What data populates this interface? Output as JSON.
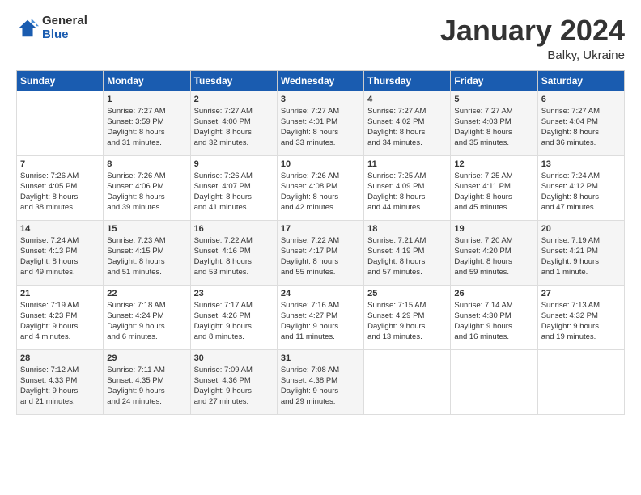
{
  "logo": {
    "general": "General",
    "blue": "Blue"
  },
  "title": "January 2024",
  "subtitle": "Balky, Ukraine",
  "days_header": [
    "Sunday",
    "Monday",
    "Tuesday",
    "Wednesday",
    "Thursday",
    "Friday",
    "Saturday"
  ],
  "weeks": [
    [
      {
        "num": "",
        "info": ""
      },
      {
        "num": "1",
        "info": "Sunrise: 7:27 AM\nSunset: 3:59 PM\nDaylight: 8 hours\nand 31 minutes."
      },
      {
        "num": "2",
        "info": "Sunrise: 7:27 AM\nSunset: 4:00 PM\nDaylight: 8 hours\nand 32 minutes."
      },
      {
        "num": "3",
        "info": "Sunrise: 7:27 AM\nSunset: 4:01 PM\nDaylight: 8 hours\nand 33 minutes."
      },
      {
        "num": "4",
        "info": "Sunrise: 7:27 AM\nSunset: 4:02 PM\nDaylight: 8 hours\nand 34 minutes."
      },
      {
        "num": "5",
        "info": "Sunrise: 7:27 AM\nSunset: 4:03 PM\nDaylight: 8 hours\nand 35 minutes."
      },
      {
        "num": "6",
        "info": "Sunrise: 7:27 AM\nSunset: 4:04 PM\nDaylight: 8 hours\nand 36 minutes."
      }
    ],
    [
      {
        "num": "7",
        "info": "Sunrise: 7:26 AM\nSunset: 4:05 PM\nDaylight: 8 hours\nand 38 minutes."
      },
      {
        "num": "8",
        "info": "Sunrise: 7:26 AM\nSunset: 4:06 PM\nDaylight: 8 hours\nand 39 minutes."
      },
      {
        "num": "9",
        "info": "Sunrise: 7:26 AM\nSunset: 4:07 PM\nDaylight: 8 hours\nand 41 minutes."
      },
      {
        "num": "10",
        "info": "Sunrise: 7:26 AM\nSunset: 4:08 PM\nDaylight: 8 hours\nand 42 minutes."
      },
      {
        "num": "11",
        "info": "Sunrise: 7:25 AM\nSunset: 4:09 PM\nDaylight: 8 hours\nand 44 minutes."
      },
      {
        "num": "12",
        "info": "Sunrise: 7:25 AM\nSunset: 4:11 PM\nDaylight: 8 hours\nand 45 minutes."
      },
      {
        "num": "13",
        "info": "Sunrise: 7:24 AM\nSunset: 4:12 PM\nDaylight: 8 hours\nand 47 minutes."
      }
    ],
    [
      {
        "num": "14",
        "info": "Sunrise: 7:24 AM\nSunset: 4:13 PM\nDaylight: 8 hours\nand 49 minutes."
      },
      {
        "num": "15",
        "info": "Sunrise: 7:23 AM\nSunset: 4:15 PM\nDaylight: 8 hours\nand 51 minutes."
      },
      {
        "num": "16",
        "info": "Sunrise: 7:22 AM\nSunset: 4:16 PM\nDaylight: 8 hours\nand 53 minutes."
      },
      {
        "num": "17",
        "info": "Sunrise: 7:22 AM\nSunset: 4:17 PM\nDaylight: 8 hours\nand 55 minutes."
      },
      {
        "num": "18",
        "info": "Sunrise: 7:21 AM\nSunset: 4:19 PM\nDaylight: 8 hours\nand 57 minutes."
      },
      {
        "num": "19",
        "info": "Sunrise: 7:20 AM\nSunset: 4:20 PM\nDaylight: 8 hours\nand 59 minutes."
      },
      {
        "num": "20",
        "info": "Sunrise: 7:19 AM\nSunset: 4:21 PM\nDaylight: 9 hours\nand 1 minute."
      }
    ],
    [
      {
        "num": "21",
        "info": "Sunrise: 7:19 AM\nSunset: 4:23 PM\nDaylight: 9 hours\nand 4 minutes."
      },
      {
        "num": "22",
        "info": "Sunrise: 7:18 AM\nSunset: 4:24 PM\nDaylight: 9 hours\nand 6 minutes."
      },
      {
        "num": "23",
        "info": "Sunrise: 7:17 AM\nSunset: 4:26 PM\nDaylight: 9 hours\nand 8 minutes."
      },
      {
        "num": "24",
        "info": "Sunrise: 7:16 AM\nSunset: 4:27 PM\nDaylight: 9 hours\nand 11 minutes."
      },
      {
        "num": "25",
        "info": "Sunrise: 7:15 AM\nSunset: 4:29 PM\nDaylight: 9 hours\nand 13 minutes."
      },
      {
        "num": "26",
        "info": "Sunrise: 7:14 AM\nSunset: 4:30 PM\nDaylight: 9 hours\nand 16 minutes."
      },
      {
        "num": "27",
        "info": "Sunrise: 7:13 AM\nSunset: 4:32 PM\nDaylight: 9 hours\nand 19 minutes."
      }
    ],
    [
      {
        "num": "28",
        "info": "Sunrise: 7:12 AM\nSunset: 4:33 PM\nDaylight: 9 hours\nand 21 minutes."
      },
      {
        "num": "29",
        "info": "Sunrise: 7:11 AM\nSunset: 4:35 PM\nDaylight: 9 hours\nand 24 minutes."
      },
      {
        "num": "30",
        "info": "Sunrise: 7:09 AM\nSunset: 4:36 PM\nDaylight: 9 hours\nand 27 minutes."
      },
      {
        "num": "31",
        "info": "Sunrise: 7:08 AM\nSunset: 4:38 PM\nDaylight: 9 hours\nand 29 minutes."
      },
      {
        "num": "",
        "info": ""
      },
      {
        "num": "",
        "info": ""
      },
      {
        "num": "",
        "info": ""
      }
    ]
  ]
}
